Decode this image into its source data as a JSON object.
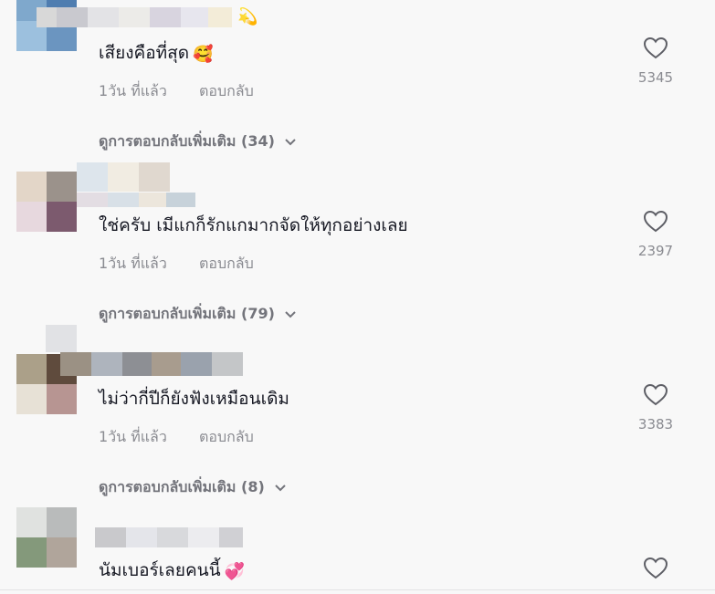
{
  "comments": [
    {
      "text": "เสียงคือที่สุด",
      "emoji": "🥰",
      "time": "1วัน ที่แล้ว",
      "reply_label": "ตอบกลับ",
      "likes": "5345",
      "more_replies": "ดูการตอบกลับเพิ่มเติม (34)",
      "avatar_colors": [
        "#7fa8cc",
        "#4f7db0",
        "#9cc0de",
        "#6b95c0"
      ],
      "name_colors": [
        "#d8d8d8",
        "#c9c9cf",
        "#e3e3e6",
        "#ecebe8",
        "#d8d4df",
        "#e7e6ee",
        "#f3ecd8"
      ],
      "decor_emoji": "💫"
    },
    {
      "text": "ใช่ครับ เมีแกก็รักแกมากจัดให้ทุกอย่างเลย",
      "emoji": "",
      "time": "1วัน ที่แล้ว",
      "reply_label": "ตอบกลับ",
      "likes": "2397",
      "more_replies": "ดูการตอบกลับเพิ่มเติม (79)",
      "avatar_colors": [
        "#e3d6c8",
        "#9b928b",
        "#e7d8de",
        "#7c5a6e"
      ],
      "name_colors": [
        "#dde5ec",
        "#f1ece2",
        "#e0d8cf",
        "#d8e0e7",
        "#c7d2da"
      ]
    },
    {
      "text": "ไม่ว่ากี่ปีก็ยังฟังเหมือนเดิม",
      "emoji": "",
      "time": "1วัน ที่แล้ว",
      "reply_label": "ตอบกลับ",
      "likes": "3383",
      "more_replies": "ดูการตอบกลับเพิ่มเติม (8)",
      "avatar_colors": [
        "#aba089",
        "#5f4b3d",
        "#e7e1d6",
        "#b79592"
      ],
      "name_colors": [
        "#9b9184",
        "#aeb4bd",
        "#8d8f94",
        "#c1c4cb",
        "#9aa2ad",
        "#c4c6c8"
      ]
    },
    {
      "text": "นัมเบอร์เลยคนนี้",
      "emoji": "💞",
      "time": "",
      "reply_label": "",
      "likes": "",
      "more_replies": "",
      "avatar_colors": [
        "#e0e2e0",
        "#b9bbbb",
        "#84997b",
        "#b0a59b"
      ],
      "name_colors": [
        "#c9c9cc",
        "#e4e5ea",
        "#d8d9dc",
        "#ececef",
        "#d0d0d4"
      ]
    }
  ],
  "icons": {
    "like": "heart-outline-icon",
    "expand": "chevron-down-icon"
  }
}
